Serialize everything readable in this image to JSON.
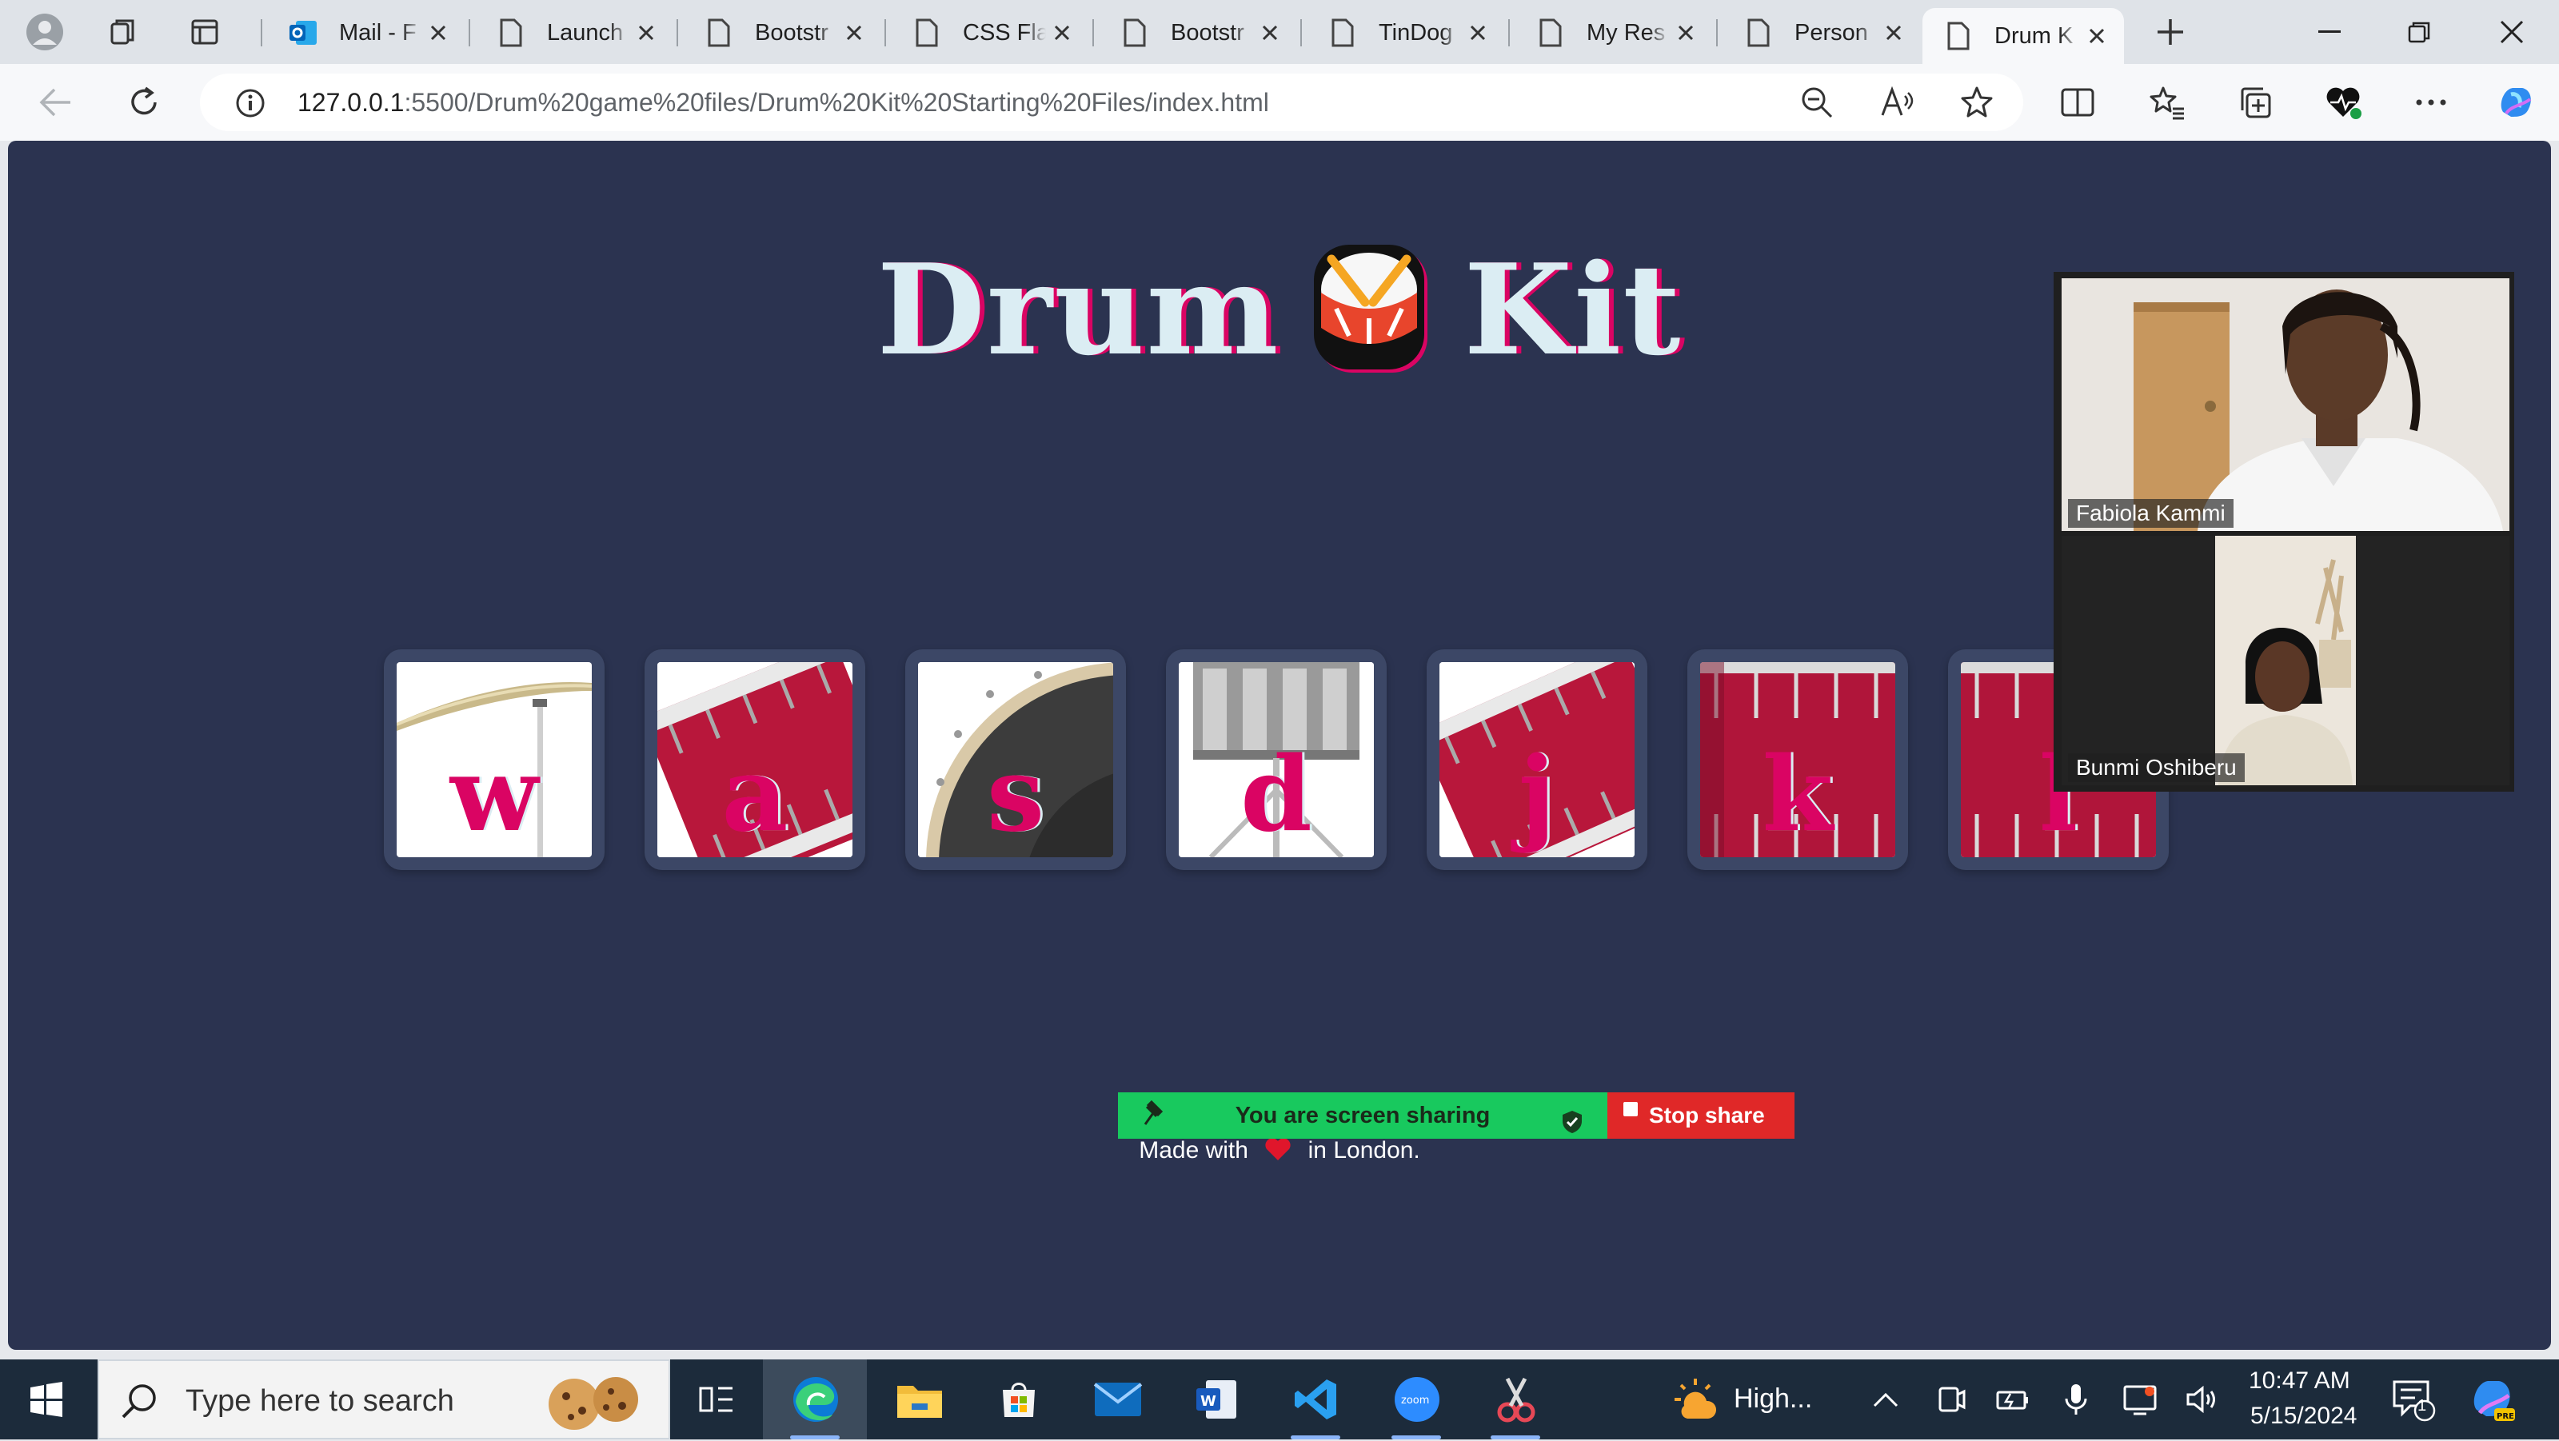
{
  "browser": {
    "tabs": [
      {
        "title": "Mail - F",
        "icon": "outlook-icon"
      },
      {
        "title": "Launch",
        "icon": "page-icon"
      },
      {
        "title": "Bootstr",
        "icon": "page-icon"
      },
      {
        "title": "CSS Fla",
        "icon": "page-icon"
      },
      {
        "title": "Bootstr",
        "icon": "page-icon"
      },
      {
        "title": "TinDog",
        "icon": "page-icon"
      },
      {
        "title": "My Res",
        "icon": "page-icon"
      },
      {
        "title": "Person",
        "icon": "page-icon"
      },
      {
        "title": "Drum K",
        "icon": "page-icon",
        "active": true
      }
    ],
    "url_host": "127.0.0.1",
    "url_rest": ":5500/Drum%20game%20files/Drum%20Kit%20Starting%20Files/index.html"
  },
  "page": {
    "title_left": "Drum",
    "title_right": "Kit",
    "pads": [
      {
        "letter": "w",
        "image": "crash"
      },
      {
        "letter": "a",
        "image": "kick"
      },
      {
        "letter": "s",
        "image": "snare"
      },
      {
        "letter": "d",
        "image": "tom1"
      },
      {
        "letter": "j",
        "image": "tom2"
      },
      {
        "letter": "k",
        "image": "tom3"
      },
      {
        "letter": "l",
        "image": "tom4"
      }
    ],
    "footer_before": "Made with",
    "footer_after": "in London."
  },
  "zoom": {
    "share_status": "You are screen sharing",
    "stop_label": "Stop share",
    "participants": [
      "Fabiola Kammi",
      "Bunmi Oshiberu"
    ]
  },
  "taskbar": {
    "search_placeholder": "Type here to search",
    "weather": "High...",
    "time": "10:47 AM",
    "date": "5/15/2024",
    "notification_count": "1"
  },
  "colors": {
    "page_bg": "#2b3350",
    "accent_pink": "#da0463",
    "share_green": "#18c95e",
    "share_red": "#e02828"
  }
}
